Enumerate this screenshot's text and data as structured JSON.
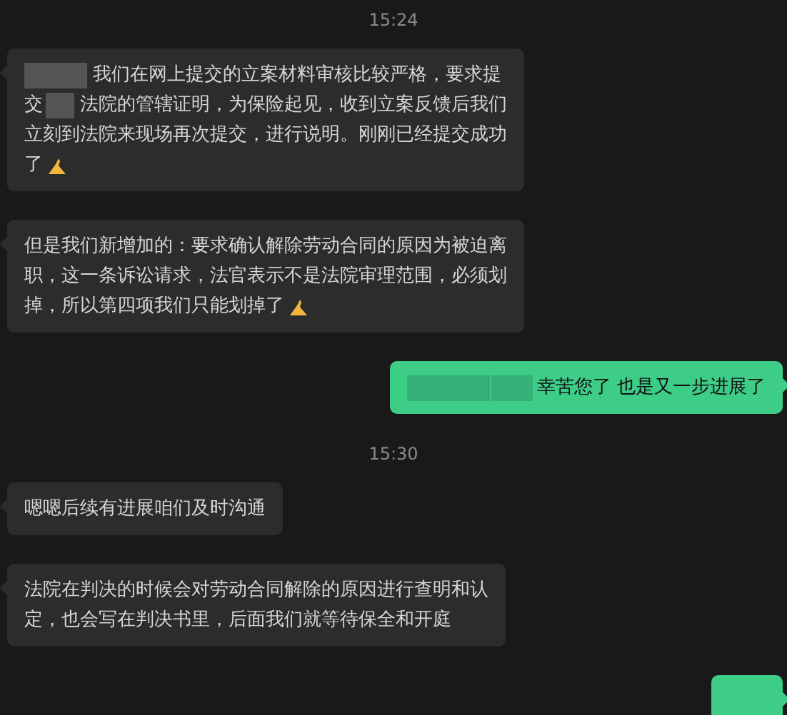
{
  "chat": [
    {
      "kind": "time",
      "text": "15:24"
    },
    {
      "kind": "message",
      "sent": false,
      "lines": [
        [
          {
            "kind": "mask_wide"
          },
          {
            "kind": "text",
            "text": "我们在网上提交的立案材料审核比较严格，要求提"
          }
        ],
        [
          {
            "kind": "text",
            "text": "交"
          },
          {
            "kind": "mask_narrow"
          },
          {
            "kind": "text",
            "text": "法院的管辖证明，为保险起见，收到立案反馈后我们"
          }
        ],
        [
          {
            "kind": "text",
            "text": "立刻到法院来现场再次提交，进行说明。刚刚已经提交成功"
          }
        ],
        [
          {
            "kind": "text",
            "text": "了"
          },
          {
            "kind": "emoji"
          }
        ]
      ]
    },
    {
      "kind": "message",
      "sent": false,
      "lines": [
        [
          {
            "kind": "text",
            "text": "但是我们新增加的：要求确认解除劳动合同的原因为被迫离"
          }
        ],
        [
          {
            "kind": "text",
            "text": "职，这一条诉讼请求，法官表示不是法院审理范围，必须划"
          }
        ],
        [
          {
            "kind": "text",
            "text": "掉，所以第四项我们只能划掉了"
          },
          {
            "kind": "emoji"
          }
        ]
      ]
    },
    {
      "kind": "message",
      "sent": true,
      "lines": [
        [
          {
            "kind": "mask_green_wide"
          },
          {
            "kind": "mask_green_narrow"
          },
          {
            "kind": "text",
            "text": "幸苦您了 也是又一步进展了"
          }
        ]
      ]
    },
    {
      "kind": "time",
      "text": "15:30"
    },
    {
      "kind": "message",
      "sent": false,
      "lines": [
        [
          {
            "kind": "text",
            "text": "嗯嗯后续有进展咱们及时沟通"
          }
        ]
      ]
    },
    {
      "kind": "message",
      "sent": false,
      "lines": [
        [
          {
            "kind": "text",
            "text": "法院在判决的时候会对劳动合同解除的原因进行查明和认"
          }
        ],
        [
          {
            "kind": "text",
            "text": "定，也会写在判决书里，后面我们就等待保全和开庭"
          }
        ]
      ]
    },
    {
      "kind": "message",
      "sent": true,
      "cut_off": true
    }
  ]
}
